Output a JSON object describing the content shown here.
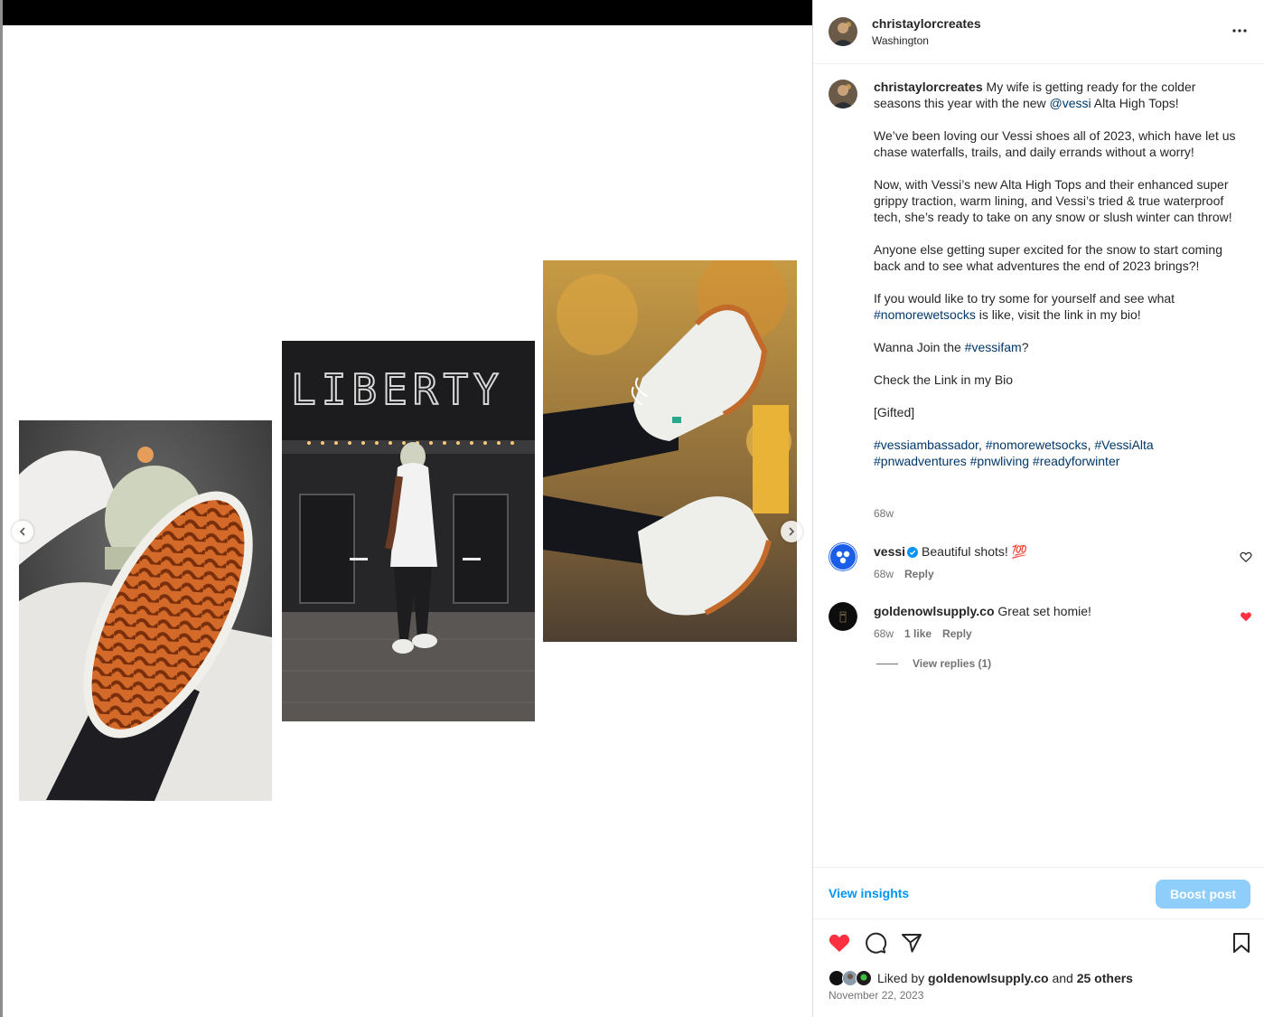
{
  "post": {
    "username": "christaylorcreates",
    "location": "Washington",
    "caption": {
      "intro_1": "My wife is getting ready for the colder seasons this year with the new ",
      "mention": "@vessi",
      "intro_2": " Alta High Tops!",
      "p2": "We’ve been loving our Vessi shoes all of 2023, which have let us chase waterfalls, trails, and daily errands without a worry!",
      "p3": "Now, with Vessi’s new Alta High Tops and their enhanced super grippy traction, warm lining, and Vessi’s tried & true waterproof tech, she’s ready to take on any snow or slush winter can throw!",
      "p4": "Anyone else getting super excited for the snow to start coming back and to see what adventures the end of 2023 brings?!",
      "p5_a": "If you would like to try some for yourself and see what ",
      "p5_tag": "#nomorewetsocks",
      "p5_b": " is like, visit the link in my bio!",
      "p6_a": "Wanna Join the ",
      "p6_tag": "#vessifam",
      "p6_b": "?",
      "p7": "Check the Link in my Bio",
      "p8": "[Gifted]",
      "tags": [
        "#vessiambassador",
        "#nomorewetsocks",
        "#VessiAlta",
        "#pnwadventures",
        "#pnwliving",
        "#readyforwinter"
      ],
      "sep_comma": ", ",
      "sep_space": " ",
      "time": "68w"
    },
    "comments": [
      {
        "username": "vessi",
        "text": "Beautiful shots! 💯",
        "time": "68w",
        "reply_label": "Reply",
        "liked": false
      },
      {
        "username": "goldenowlsupply.co",
        "text": "Great set homie!",
        "time": "68w",
        "likes": "1 like",
        "reply_label": "Reply",
        "liked": true,
        "view_replies": "View replies (1)"
      }
    ],
    "insights_label": "View insights",
    "boost_label": "Boost post",
    "liked_by": {
      "prefix": "Liked by ",
      "user": "goldenowlsupply.co",
      "and": " and ",
      "others": "25 others"
    },
    "date": "November 22, 2023"
  },
  "media": {
    "sign_text": "LIBERTY"
  },
  "icons": {
    "prev": "chevron-left-icon",
    "next": "chevron-right-icon",
    "more": "more-horizontal-icon",
    "like": "heart-icon",
    "comment": "comment-icon",
    "share": "share-icon",
    "save": "bookmark-icon",
    "verified": "verified-badge-icon"
  },
  "colors": {
    "link": "#00376b",
    "accent": "#0095f6",
    "boost_disabled": "#8fcdfb",
    "liked_red": "#ff3040",
    "muted": "#737373"
  }
}
